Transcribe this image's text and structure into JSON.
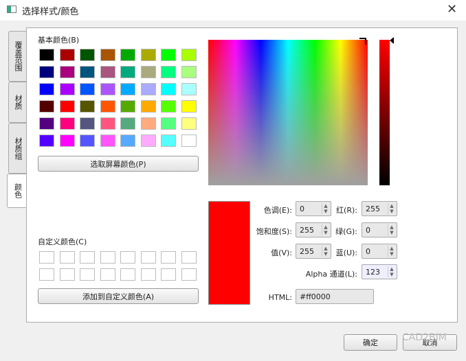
{
  "window": {
    "title": "选择样式/颜色",
    "close": "✕"
  },
  "tabs": [
    "覆盖范围",
    "材质",
    "材质组",
    "颜色"
  ],
  "basic": {
    "label": "基本颜色(B)",
    "colors": [
      "#000000",
      "#aa0000",
      "#005500",
      "#aa5500",
      "#00aa00",
      "#aaaa00",
      "#00ff00",
      "#aaff00",
      "#00007f",
      "#aa007f",
      "#00557f",
      "#aa557f",
      "#00aa7f",
      "#aaaa7f",
      "#00ff7f",
      "#aaff7f",
      "#0000ff",
      "#aa00ff",
      "#0055ff",
      "#aa55ff",
      "#00aaff",
      "#aaaaff",
      "#00ffff",
      "#aaffff",
      "#550000",
      "#ff0000",
      "#555500",
      "#ff5500",
      "#55aa00",
      "#ffaa00",
      "#55ff00",
      "#ffff00",
      "#55007f",
      "#ff007f",
      "#55557f",
      "#ff557f",
      "#55aa7f",
      "#ffaa7f",
      "#55ff7f",
      "#ffff7f",
      "#5500ff",
      "#ff00ff",
      "#5555ff",
      "#ff55ff",
      "#55aaff",
      "#ffaaff",
      "#55ffff",
      "#ffffff"
    ]
  },
  "pick_screen": "选取屏幕颜色(P)",
  "custom": {
    "label": "自定义颜色(C)",
    "add": "添加到自定义颜色(A)"
  },
  "current_color": "#ff0000",
  "fields": {
    "hue": {
      "label": "色调(E):",
      "value": "0"
    },
    "sat": {
      "label": "饱和度(S):",
      "value": "255"
    },
    "val": {
      "label": "值(V):",
      "value": "255"
    },
    "red": {
      "label": "红(R):",
      "value": "255"
    },
    "green": {
      "label": "绿(G):",
      "value": "0"
    },
    "blue": {
      "label": "蓝(U):",
      "value": "0"
    },
    "alpha": {
      "label": "Alpha 通道(L):",
      "value": "123"
    },
    "html": {
      "label": "HTML:",
      "value": "#ff0000"
    }
  },
  "buttons": {
    "ok": "确定",
    "cancel": "取消"
  },
  "watermark": "CAD2BIM"
}
